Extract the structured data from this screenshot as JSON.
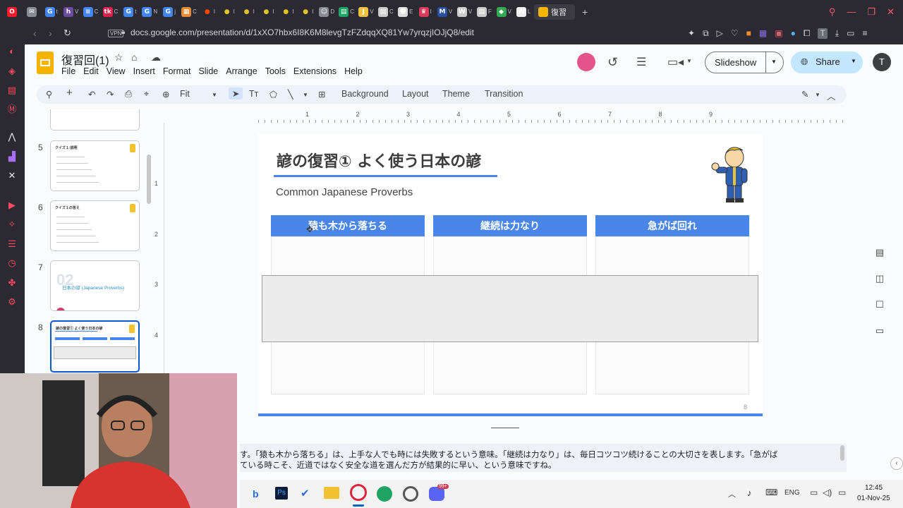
{
  "browser": {
    "tabs": [
      {
        "icon": "opera-logo-icon",
        "color": "#ff1b2d",
        "glyph": "O"
      },
      {
        "icon": "mail-icon",
        "color": "#8a8a95",
        "glyph": "✉"
      },
      {
        "icon": "google-icon",
        "color": "#4285f4",
        "glyph": "G",
        "label": "t"
      },
      {
        "icon": "h-site-icon",
        "color": "#6b4aa0",
        "glyph": "h",
        "label": "V"
      },
      {
        "icon": "docs-icon",
        "color": "#4285f4",
        "glyph": "≡",
        "label": "C"
      },
      {
        "icon": "tiktok-icon",
        "color": "#e0204a",
        "glyph": "tk",
        "label": "C"
      },
      {
        "icon": "google-icon",
        "color": "#4285f4",
        "glyph": "G",
        "label": "t"
      },
      {
        "icon": "google-icon",
        "color": "#4285f4",
        "glyph": "G",
        "label": "N"
      },
      {
        "icon": "google-icon",
        "color": "#4285f4",
        "glyph": "G",
        "label": "j"
      },
      {
        "icon": "grid-site-icon",
        "color": "#e88b2e",
        "glyph": "▦",
        "label": "C"
      },
      {
        "icon": "reddit-icon",
        "color": "#ff4500",
        "glyph": "●",
        "label": "I"
      },
      {
        "icon": "dot-icon",
        "color": "#e0c225",
        "glyph": "●",
        "label": "I"
      },
      {
        "icon": "dot-icon",
        "color": "#e0c225",
        "glyph": "●",
        "label": "I"
      },
      {
        "icon": "dot-icon",
        "color": "#e0c225",
        "glyph": "●",
        "label": "I"
      },
      {
        "icon": "dot-icon",
        "color": "#e0c225",
        "glyph": "●",
        "label": "I"
      },
      {
        "icon": "dot-icon",
        "color": "#e0c225",
        "glyph": "●",
        "label": "I"
      },
      {
        "icon": "people-icon",
        "color": "#8a8a95",
        "glyph": "☺",
        "label": "D"
      },
      {
        "icon": "sheets-icon",
        "color": "#1fa463",
        "glyph": "▤",
        "label": "C"
      },
      {
        "icon": "j-site-icon",
        "color": "#f0c040",
        "glyph": "J",
        "label": "V"
      },
      {
        "icon": "page-icon",
        "color": "#cccccc",
        "glyph": "▤",
        "label": "C"
      },
      {
        "icon": "mask-icon",
        "color": "#dddddd",
        "glyph": "☻",
        "label": "E"
      },
      {
        "icon": "crown-icon",
        "color": "#d83a5a",
        "glyph": "♛",
        "label": "I"
      },
      {
        "icon": "m-site-icon",
        "color": "#2a4ea0",
        "glyph": "M",
        "label": "V"
      },
      {
        "icon": "w-site-icon",
        "color": "#cccccc",
        "glyph": "W",
        "label": "V"
      },
      {
        "icon": "page-icon",
        "color": "#cccccc",
        "glyph": "▤",
        "label": "F"
      },
      {
        "icon": "maps-icon",
        "color": "#34a853",
        "glyph": "◆",
        "label": "V"
      },
      {
        "icon": "wikipedia-icon",
        "color": "#eeeeee",
        "glyph": "W",
        "label": "L"
      }
    ],
    "active_tab": "復習",
    "url": "docs.google.com/presentation/d/1xXO7hbx6I8K6M8levgTzFZdqqXQ81Yw7yrqzjIOJjQ8/edit",
    "vpn_label": "VPN"
  },
  "docs": {
    "title": "復習回(1)",
    "menu": [
      "File",
      "Edit",
      "View",
      "Insert",
      "Format",
      "Slide",
      "Arrange",
      "Tools",
      "Extensions",
      "Help"
    ],
    "slideshow_label": "Slideshow",
    "share_label": "Share",
    "avatar_letter": "T",
    "toolbar": {
      "zoom": "Fit",
      "background": "Background",
      "layout": "Layout",
      "theme": "Theme",
      "transition": "Transition"
    },
    "ruler": [
      "1",
      "2",
      "3",
      "4",
      "5",
      "6",
      "7",
      "8",
      "9"
    ],
    "vruler": [
      "1",
      "2",
      "3",
      "4"
    ]
  },
  "filmstrip": [
    {
      "num": "5",
      "title": "クイズ１:説明"
    },
    {
      "num": "6",
      "title": "クイズ１の答え"
    },
    {
      "num": "7",
      "title": "日本の諺 (Japanese Proverbs)",
      "big": "02"
    },
    {
      "num": "8",
      "title": "諺の復習① よく使う日本の諺"
    }
  ],
  "slide": {
    "title": "諺の復習① よく使う日本の諺",
    "subtitle": "Common Japanese Proverbs",
    "headers": [
      "猿も木から落ちる",
      "継続は力なり",
      "急がば回れ"
    ],
    "page_number": "8"
  },
  "notes": {
    "line1": "す。「猿も木から落ちる」は、上手な人でも時には失敗するという意味。「継続は力なり」は、毎日コツコツ続けることの大切さを表します。「急がば",
    "line2": "ている時こそ、近道ではなく安全な道を選んだ方が結果的に早い、という意味ですね。"
  },
  "taskbar": {
    "lang": "ENG",
    "time": "12:45",
    "date": "01-Nov-25",
    "badge": "99+"
  },
  "colors": {
    "accent": "#4a86e8",
    "share_bg": "#c2e7ff",
    "toolbar_bg": "#edf2fa"
  }
}
